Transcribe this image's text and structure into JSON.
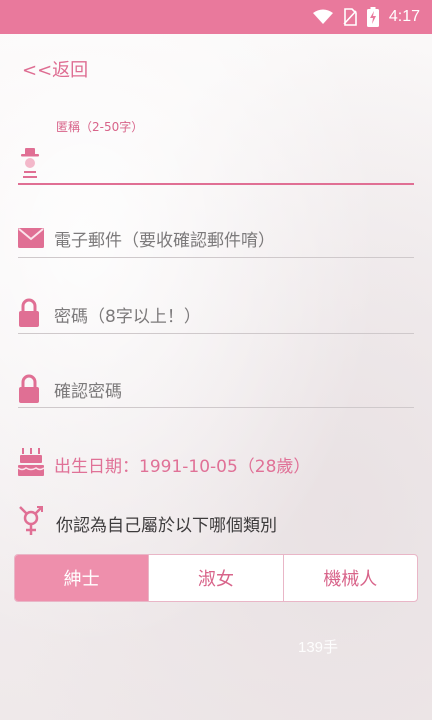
{
  "status_bar": {
    "time": "4:17"
  },
  "back": {
    "label": "<<返回"
  },
  "nickname": {
    "label": "匿稱（2-50字）",
    "value": ""
  },
  "email": {
    "placeholder": "電子郵件（要收確認郵件唷）"
  },
  "password": {
    "placeholder": "密碼（8字以上！）"
  },
  "confirm_password": {
    "placeholder": "確認密碼"
  },
  "birthday": {
    "text": "出生日期：1991-10-05（28歲）"
  },
  "gender": {
    "question": "你認為自己屬於以下哪個類別",
    "options": [
      "紳士",
      "淑女",
      "機械人"
    ],
    "selected": "紳士"
  },
  "watermark": "139手",
  "colors": {
    "accent": "#e9799c",
    "selected_segment": "#ee8fac",
    "icon": "#e06f94"
  }
}
